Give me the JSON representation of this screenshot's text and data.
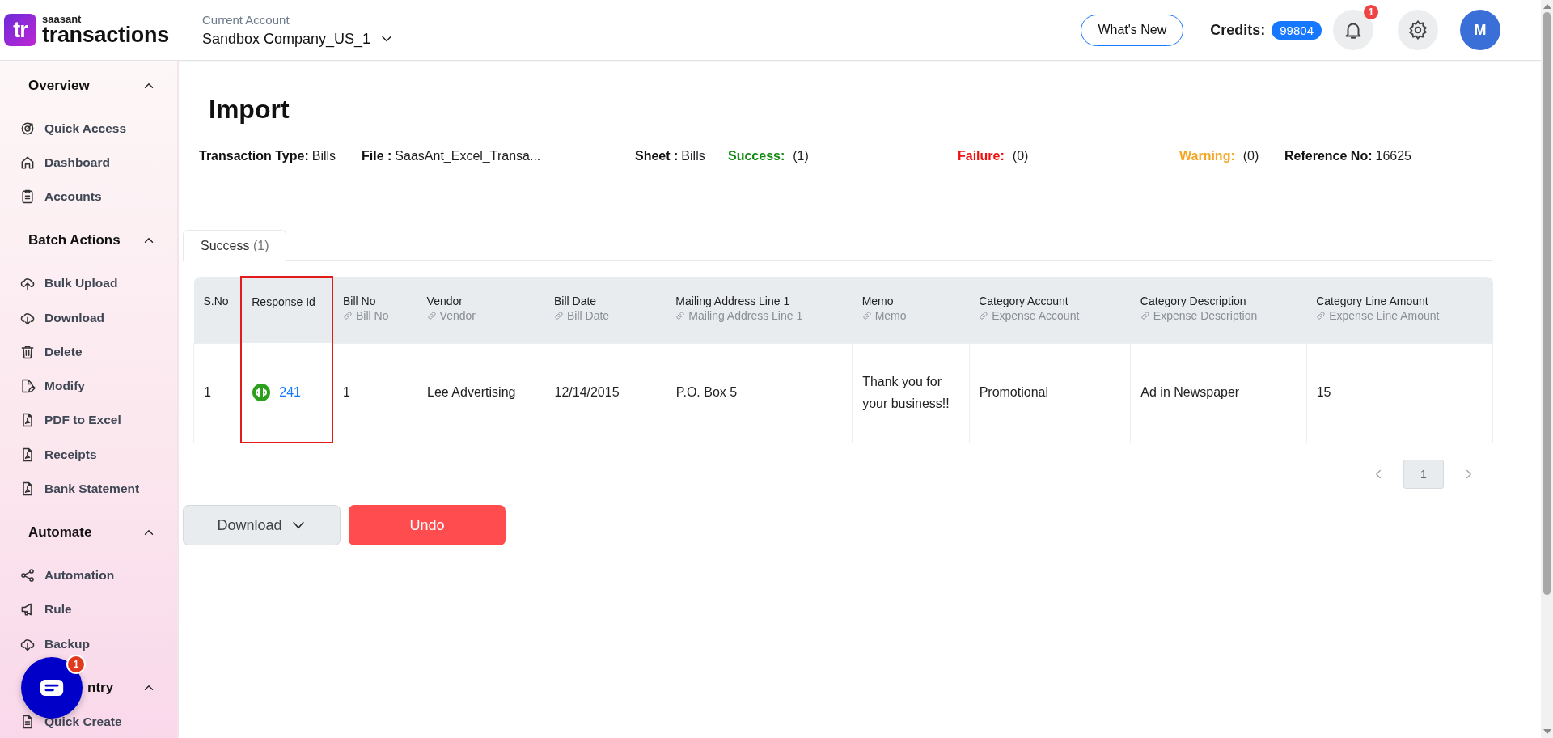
{
  "app": {
    "brand_small": "saasant",
    "brand_name": "transactions",
    "logo_text": "tr"
  },
  "header": {
    "account_label": "Current Account",
    "account_name": "Sandbox Company_US_1",
    "whats_new": "What's New",
    "credits_label": "Credits:",
    "credits_value": "99804",
    "notification_count": "1",
    "avatar_initial": "M"
  },
  "sidebar": {
    "sections": [
      {
        "title": "Overview",
        "expanded": true,
        "items": [
          {
            "label": "Quick Access"
          },
          {
            "label": "Dashboard"
          },
          {
            "label": "Accounts"
          }
        ]
      },
      {
        "title": "Batch Actions",
        "expanded": true,
        "items": [
          {
            "label": "Bulk Upload"
          },
          {
            "label": "Download"
          },
          {
            "label": "Delete"
          },
          {
            "label": "Modify"
          },
          {
            "label": "PDF to Excel"
          },
          {
            "label": "Receipts"
          },
          {
            "label": "Bank Statement"
          }
        ]
      },
      {
        "title": "Automate",
        "expanded": true,
        "items": [
          {
            "label": "Automation"
          },
          {
            "label": "Rule"
          },
          {
            "label": "Backup"
          }
        ]
      },
      {
        "title": "ntry",
        "expanded": true,
        "items": [
          {
            "label": "Quick Create"
          }
        ]
      }
    ]
  },
  "chat": {
    "badge": "1"
  },
  "page": {
    "title": "Import"
  },
  "summary": [
    {
      "label": "Transaction Type:",
      "value": "Bills",
      "kind": "plain"
    },
    {
      "label": "File :",
      "value": "SaasAnt_Excel_Transa...",
      "kind": "plain"
    },
    {
      "label": "Sheet :",
      "value": "Bills",
      "kind": "plain"
    },
    {
      "label": "Success:",
      "value": "(1)",
      "kind": "success"
    },
    {
      "label": "Failure:",
      "value": "(0)",
      "kind": "failure"
    },
    {
      "label": "Warning:",
      "value": "(0)",
      "kind": "warning"
    },
    {
      "label": "Reference No:",
      "value": "16625",
      "kind": "plain"
    }
  ],
  "tabs": [
    {
      "label": "Success",
      "count": "(1)",
      "selected": true
    }
  ],
  "table": {
    "columns": [
      {
        "title": "S.No",
        "highlighted": false
      },
      {
        "title": "Response Id",
        "highlighted": true
      },
      {
        "title": "Bill No",
        "mapping": "Bill No",
        "highlighted": false
      },
      {
        "title": "Vendor",
        "mapping": "Vendor",
        "highlighted": false
      },
      {
        "title": "Bill Date",
        "mapping": "Bill Date",
        "highlighted": false
      },
      {
        "title": "Mailing Address Line 1",
        "mapping": "Mailing Address Line 1",
        "highlighted": false
      },
      {
        "title": "Memo",
        "mapping": "Memo",
        "highlighted": false
      },
      {
        "title": "Category Account",
        "mapping": "Expense Account",
        "highlighted": false
      },
      {
        "title": "Category Description",
        "mapping": "Expense Description",
        "highlighted": false
      },
      {
        "title": "Category Line Amount",
        "mapping": "Expense Line Amount",
        "highlighted": false
      }
    ],
    "rows": [
      {
        "cells": [
          "1",
          "241",
          "1",
          "Lee Advertising",
          "12/14/2015",
          "P.O. Box 5",
          "Thank you for your business!!",
          "Promotional",
          "Ad in Newspaper",
          "15"
        ]
      }
    ]
  },
  "pagination": {
    "pages": [
      {
        "label": "1",
        "selected": true
      }
    ]
  },
  "actions": {
    "download": "Download",
    "undo": "Undo"
  }
}
